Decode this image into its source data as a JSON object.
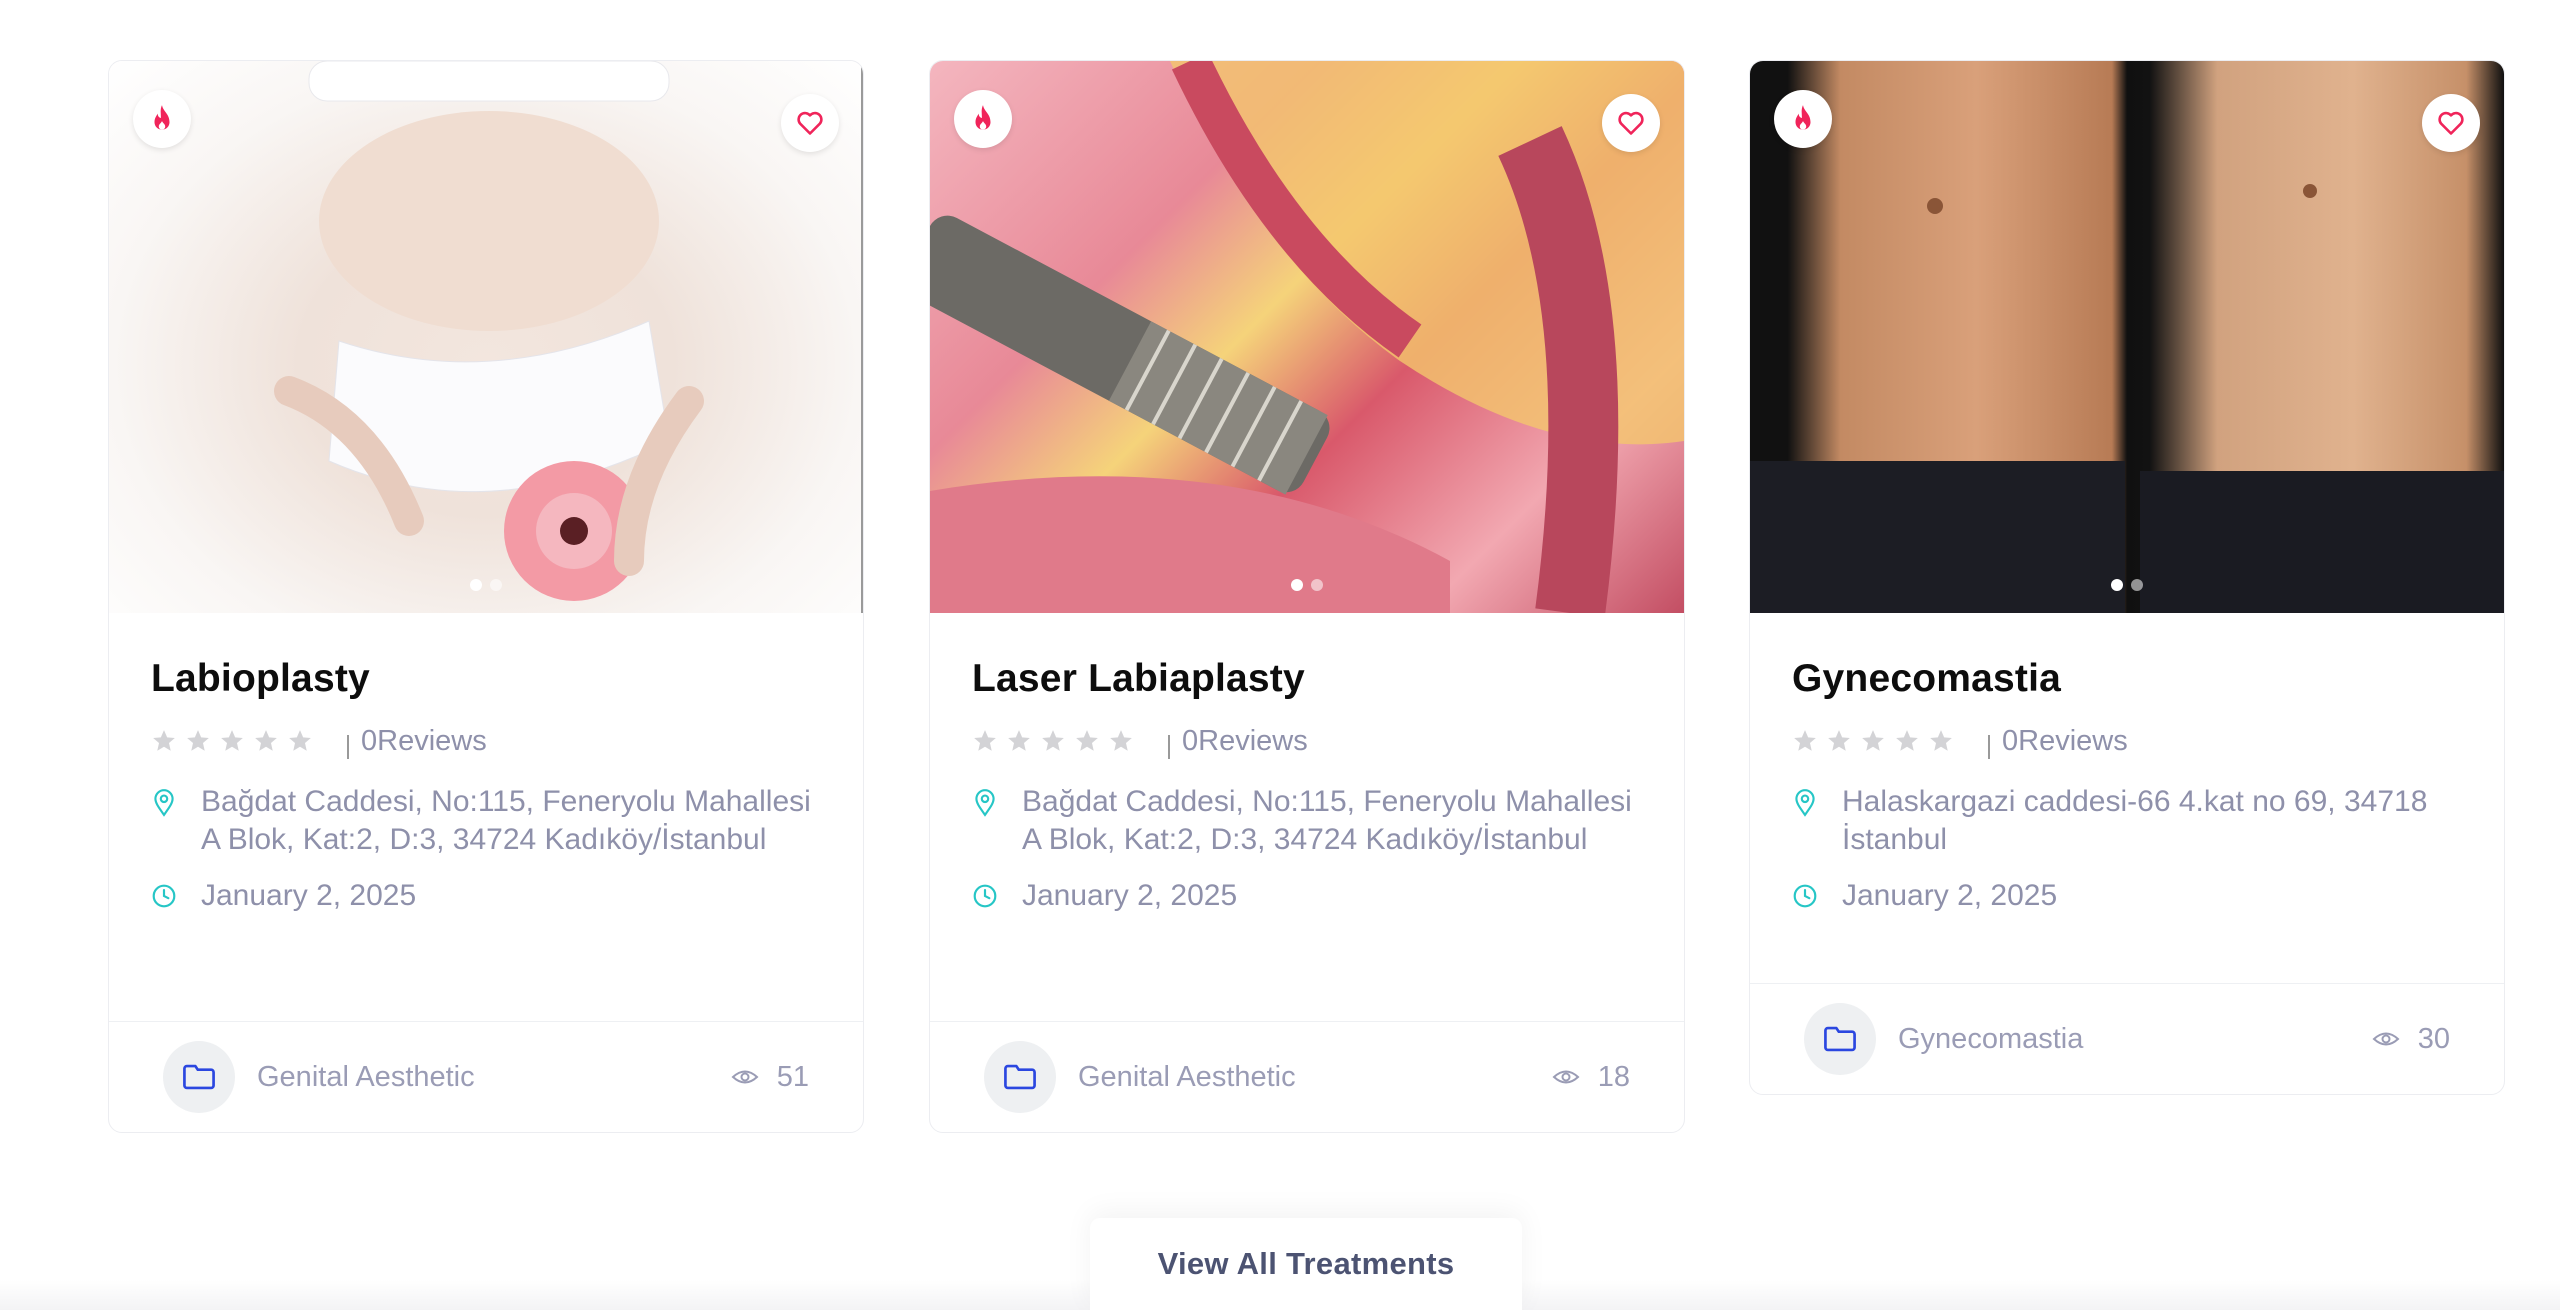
{
  "cards": [
    {
      "title": "Labioplasty",
      "rating_count": 0,
      "reviews_label": "0Reviews",
      "stars_filled": 0,
      "stars_total": 5,
      "address": "Bağdat Caddesi, No:115, Feneryolu Mahallesi A Blok, Kat:2, D:3, 34724 Kadıköy/İstanbul",
      "date": "January 2, 2025",
      "category": "Genital Aesthetic",
      "views": "51",
      "slides_total": 2,
      "slide_active": 1,
      "icons": [
        "fire-icon",
        "heart-icon",
        "location-pin-icon",
        "clock-icon",
        "folder-icon",
        "eye-icon"
      ]
    },
    {
      "title": "Laser Labiaplasty",
      "rating_count": 0,
      "reviews_label": "0Reviews",
      "stars_filled": 0,
      "stars_total": 5,
      "address": "Bağdat Caddesi, No:115, Feneryolu Mahallesi A Blok, Kat:2, D:3, 34724 Kadıköy/İstanbul",
      "date": "January 2, 2025",
      "category": "Genital Aesthetic",
      "views": "18",
      "slides_total": 2,
      "slide_active": 1,
      "icons": [
        "fire-icon",
        "heart-icon",
        "location-pin-icon",
        "clock-icon",
        "folder-icon",
        "eye-icon"
      ]
    },
    {
      "title": "Gynecomastia",
      "rating_count": 0,
      "reviews_label": "0Reviews",
      "stars_filled": 0,
      "stars_total": 5,
      "address": "Halaskargazi caddesi-66 4.kat no 69, 34718 İstanbul",
      "date": "January 2, 2025",
      "category": "Gynecomastia",
      "views": "30",
      "slides_total": 2,
      "slide_active": 1,
      "icons": [
        "fire-icon",
        "heart-icon",
        "location-pin-icon",
        "clock-icon",
        "folder-icon",
        "eye-icon"
      ]
    }
  ],
  "view_all_label": "View All Treatments",
  "colors": {
    "accent_pink": "#f0245a",
    "accent_teal": "#26c6c6",
    "folder_blue": "#2b47e0",
    "muted_text": "#8e90aa",
    "star_gray": "#d3d3d6"
  }
}
